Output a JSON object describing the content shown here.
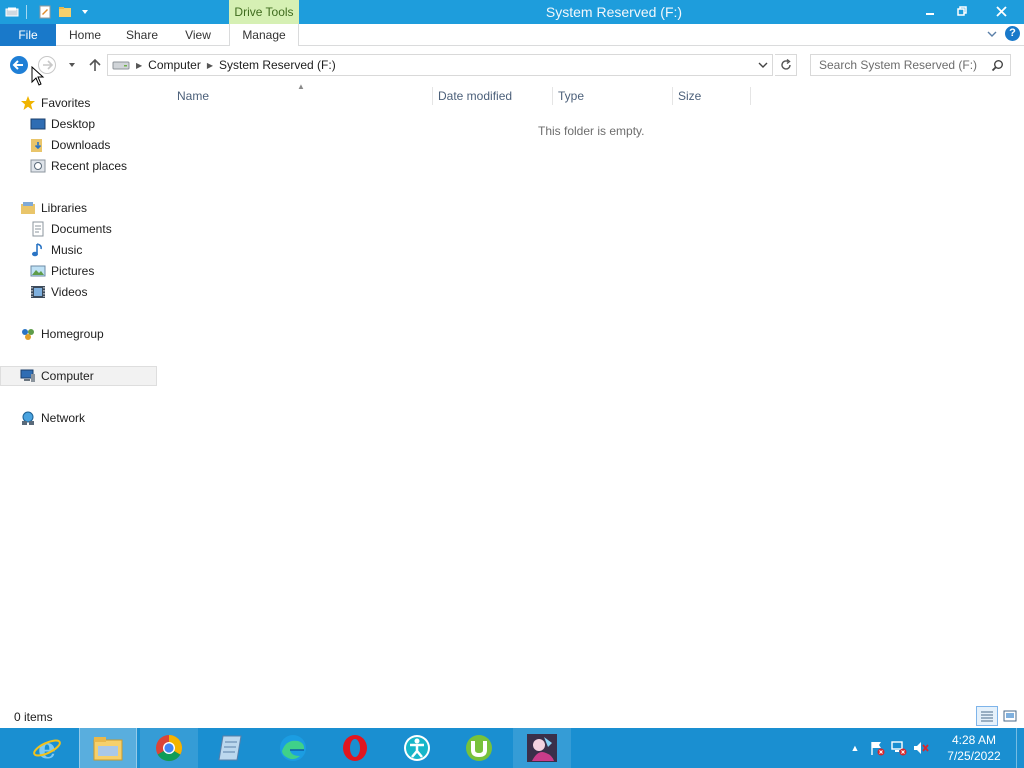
{
  "window": {
    "title": "System Reserved (F:)",
    "contextual_tab_group": "Drive Tools"
  },
  "ribbon": {
    "tabs": [
      {
        "label": "File"
      },
      {
        "label": "Home"
      },
      {
        "label": "Share"
      },
      {
        "label": "View"
      },
      {
        "label": "Manage"
      }
    ],
    "help_label": "?"
  },
  "address": {
    "crumbs": [
      "Computer",
      "System Reserved (F:)"
    ]
  },
  "search": {
    "placeholder": "Search System Reserved (F:)"
  },
  "nav_pane": {
    "favorites": {
      "label": "Favorites",
      "items": [
        {
          "label": "Desktop"
        },
        {
          "label": "Downloads"
        },
        {
          "label": "Recent places"
        }
      ]
    },
    "libraries": {
      "label": "Libraries",
      "items": [
        {
          "label": "Documents"
        },
        {
          "label": "Music"
        },
        {
          "label": "Pictures"
        },
        {
          "label": "Videos"
        }
      ]
    },
    "homegroup": {
      "label": "Homegroup"
    },
    "computer": {
      "label": "Computer"
    },
    "network": {
      "label": "Network"
    }
  },
  "content": {
    "columns": [
      {
        "label": "Name"
      },
      {
        "label": "Date modified"
      },
      {
        "label": "Type"
      },
      {
        "label": "Size"
      }
    ],
    "empty_message": "This folder is empty."
  },
  "status": {
    "item_count": "0 items"
  },
  "taskbar": {
    "apps": [
      {
        "name": "internet-explorer"
      },
      {
        "name": "file-explorer"
      },
      {
        "name": "chrome"
      },
      {
        "name": "notepad"
      },
      {
        "name": "edge"
      },
      {
        "name": "opera"
      },
      {
        "name": "accessibility-app"
      },
      {
        "name": "utorrent"
      },
      {
        "name": "photo-app"
      }
    ],
    "clock": {
      "time": "4:28 AM",
      "date": "7/25/2022"
    }
  },
  "colors": {
    "titlebar": "#1e9ddc",
    "file_tab": "#1979ca",
    "drive_tools": "#d6f0b4",
    "taskbar": "#1a8fd1"
  }
}
